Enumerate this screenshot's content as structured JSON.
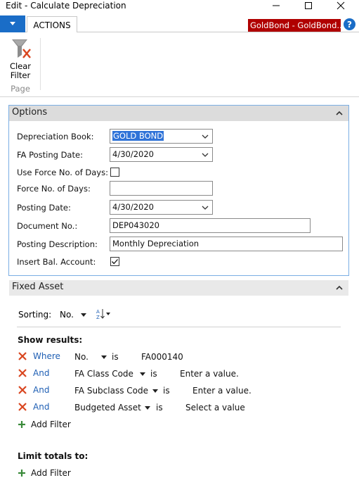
{
  "window": {
    "title": "Edit - Calculate Depreciation"
  },
  "ribbon": {
    "tab_actions": "ACTIONS",
    "company": "GoldBond - GoldBond...",
    "help": "?",
    "clear_filter_label_1": "Clear",
    "clear_filter_label_2": "Filter",
    "group_label": "Page"
  },
  "options": {
    "title": "Options",
    "fields": {
      "depreciation_book": {
        "label": "Depreciation Book:",
        "value": "GOLD BOND"
      },
      "fa_posting_date": {
        "label": "FA Posting Date:",
        "value": "4/30/2020"
      },
      "use_force_no_of_days": {
        "label": "Use Force No. of Days:",
        "checked": false
      },
      "force_no_of_days": {
        "label": "Force No. of Days:",
        "value": ""
      },
      "posting_date": {
        "label": "Posting Date:",
        "value": "4/30/2020"
      },
      "document_no": {
        "label": "Document No.:",
        "value": "DEP043020"
      },
      "posting_description": {
        "label": "Posting Description:",
        "value": "Monthly Depreciation"
      },
      "insert_bal_account": {
        "label": "Insert Bal. Account:",
        "checked": true
      }
    }
  },
  "fixed_asset": {
    "title": "Fixed Asset",
    "sorting_label": "Sorting:",
    "sorting_value": "No.",
    "sort_order_icon": "az-sort-icon",
    "show_results_label": "Show results:",
    "filters": [
      {
        "connector": "Where",
        "field": "No.",
        "is": "is",
        "value": "FA000140"
      },
      {
        "connector": "And",
        "field": "FA Class Code",
        "is": "is",
        "value": "Enter a value."
      },
      {
        "connector": "And",
        "field": "FA Subclass Code",
        "is": "is",
        "value": "Enter a value."
      },
      {
        "connector": "And",
        "field": "Budgeted Asset",
        "is": "is",
        "value": "Select a value"
      }
    ],
    "add_filter": "Add Filter",
    "limit_totals_label": "Limit totals to:",
    "limit_add_filter": "Add Filter"
  },
  "colors": {
    "accent_blue": "#1a6dc7",
    "company_red": "#b00000",
    "link_blue": "#1f5fb4",
    "remove_red": "#d9461f",
    "add_green": "#3a8a3a"
  }
}
